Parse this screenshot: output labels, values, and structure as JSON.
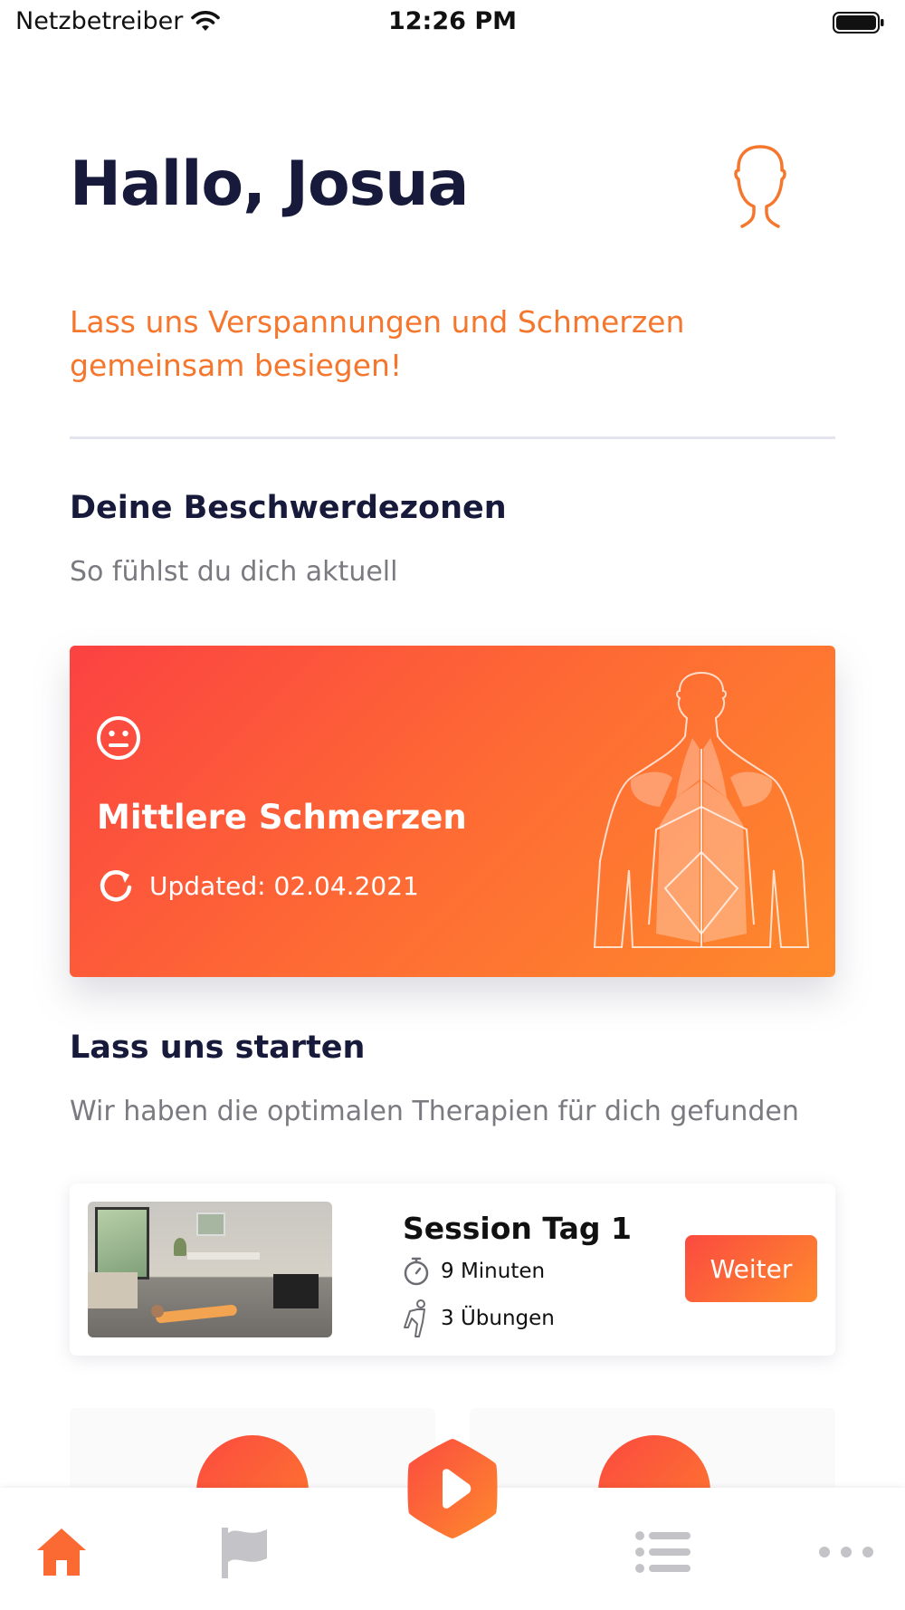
{
  "status_bar": {
    "carrier": "Netzbetreiber",
    "time": "12:26 PM"
  },
  "header": {
    "greeting": "Hallo, Josua",
    "tagline": "Lass uns Verspannungen und Schmerzen gemeinsam besiegen!",
    "profile_icon": "person-outline-icon"
  },
  "zones": {
    "title": "Deine Beschwerdezonen",
    "subtitle": "So fühlst du dich aktuell",
    "card": {
      "face_icon": "neutral-face-icon",
      "pain_level": "Mittlere Schmerzen",
      "updated": "Updated: 02.04.2021",
      "figure_icon": "back-body-icon"
    }
  },
  "start": {
    "title": "Lass uns starten",
    "subtitle": "Wir haben die optimalen Therapien für dich gefunden",
    "session": {
      "title": "Session Tag 1",
      "duration": "9 Minuten",
      "exercises": "3 Übungen",
      "button": "Weiter"
    }
  },
  "tab_bar": {
    "items": [
      "home-icon",
      "flag-icon",
      "play-icon",
      "list-icon",
      "more-icon"
    ],
    "active": "home-icon"
  },
  "colors": {
    "accent": "#f5762d",
    "gradient_start": "#fb4242",
    "gradient_end": "#fe8a2c",
    "heading": "#171a3a",
    "muted": "#7a7a80"
  }
}
